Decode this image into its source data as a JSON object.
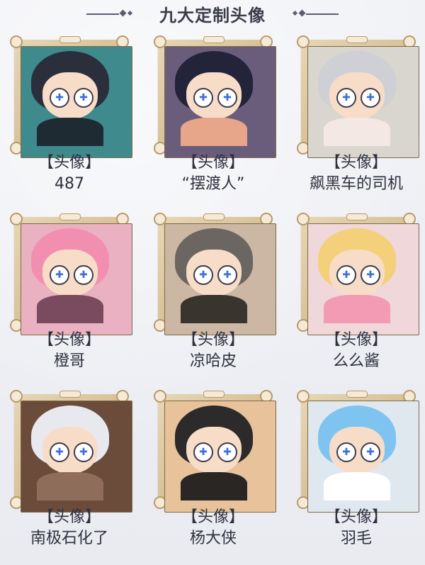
{
  "header": {
    "title": "九大定制头像"
  },
  "avatars": [
    {
      "tag": "【头像】",
      "name": "487",
      "colors": {
        "bg": "#3e8a8c",
        "hair": "#2b2f3c",
        "body": "#1e2b33"
      }
    },
    {
      "tag": "【头像】",
      "name": "“摆渡人”",
      "colors": {
        "bg": "#6a5d7c",
        "hair": "#23233a",
        "body": "#e7a58a"
      }
    },
    {
      "tag": "【头像】",
      "name": "飙黑车的司机",
      "colors": {
        "bg": "#d9d5cf",
        "hair": "#cfcfd6",
        "body": "#f3e8e3"
      }
    },
    {
      "tag": "【头像】",
      "name": "橙哥",
      "colors": {
        "bg": "#e9b1c2",
        "hair": "#f28fb1",
        "body": "#7a4a5e"
      }
    },
    {
      "tag": "【头像】",
      "name": "凉哈皮",
      "colors": {
        "bg": "#cbb7a3",
        "hair": "#6b6661",
        "body": "#3a342f"
      }
    },
    {
      "tag": "【头像】",
      "name": "么么酱",
      "colors": {
        "bg": "#f0d7d9",
        "hair": "#f4d07a",
        "body": "#f39ab4"
      }
    },
    {
      "tag": "【头像】",
      "name": "南极石化了",
      "colors": {
        "bg": "#6b4b3a",
        "hair": "#e8e9ef",
        "body": "#8e6e5a"
      }
    },
    {
      "tag": "【头像】",
      "name": "杨大侠",
      "colors": {
        "bg": "#e7c29a",
        "hair": "#2c2a2a",
        "body": "#2a2623"
      }
    },
    {
      "tag": "【头像】",
      "name": "羽毛",
      "colors": {
        "bg": "#dfe8ef",
        "hair": "#7fc4f0",
        "body": "#ffffff"
      }
    }
  ]
}
